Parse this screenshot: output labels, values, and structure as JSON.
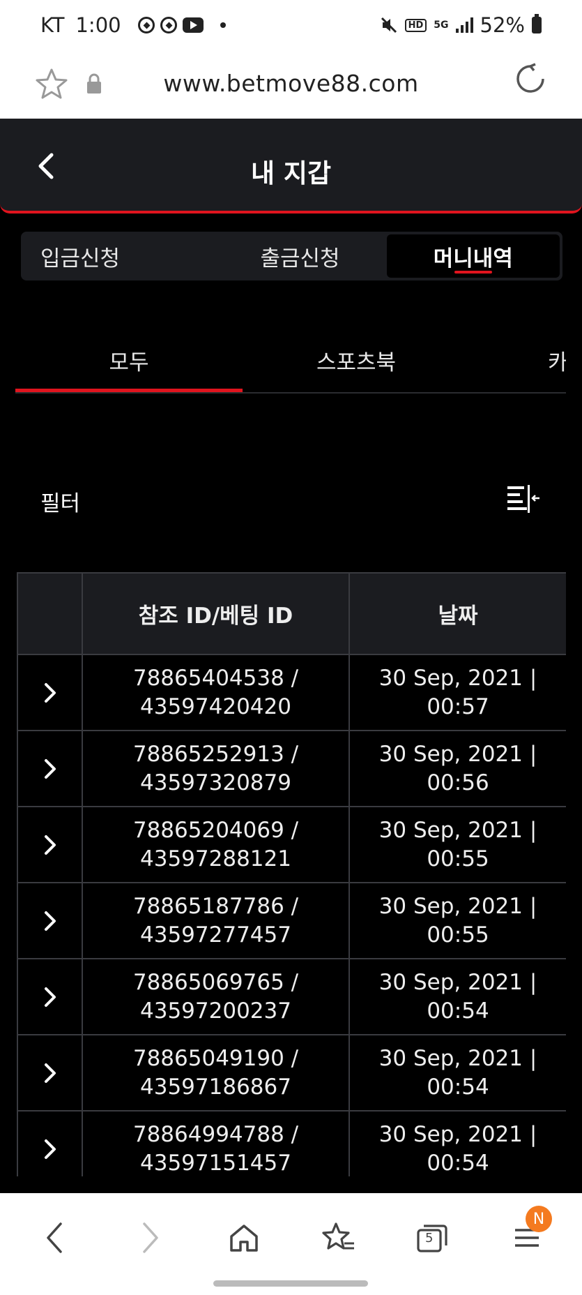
{
  "status_bar": {
    "carrier": "KT",
    "time": "1:00",
    "hd": "HD",
    "network": "5G",
    "battery": "52%"
  },
  "browser": {
    "url": "www.betmove88.com",
    "tab_count": "5",
    "menu_badge": "N"
  },
  "header": {
    "title": "내 지갑"
  },
  "segments": {
    "deposit": "입금신청",
    "withdraw": "출금신청",
    "history": "머니내역"
  },
  "subtabs": {
    "all": "모두",
    "sportsbook": "스포츠북",
    "next": "카"
  },
  "filter": {
    "label": "필터"
  },
  "table": {
    "headers": [
      "",
      "참조 ID/베팅 ID",
      "날짜"
    ],
    "rows": [
      {
        "ref": "78865404538 /",
        "bet": "43597420420",
        "date": "30 Sep, 2021 |",
        "time": "00:57"
      },
      {
        "ref": "78865252913 /",
        "bet": "43597320879",
        "date": "30 Sep, 2021 |",
        "time": "00:56"
      },
      {
        "ref": "78865204069 /",
        "bet": "43597288121",
        "date": "30 Sep, 2021 |",
        "time": "00:55"
      },
      {
        "ref": "78865187786 /",
        "bet": "43597277457",
        "date": "30 Sep, 2021 |",
        "time": "00:55"
      },
      {
        "ref": "78865069765 /",
        "bet": "43597200237",
        "date": "30 Sep, 2021 |",
        "time": "00:54"
      },
      {
        "ref": "78865049190 /",
        "bet": "43597186867",
        "date": "30 Sep, 2021 |",
        "time": "00:54"
      },
      {
        "ref": "78864994788 /",
        "bet": "43597151457",
        "date": "30 Sep, 2021 |",
        "time": "00:54"
      }
    ]
  },
  "colors": {
    "accent": "#e0141e",
    "header_bg": "#1b1c20",
    "badge": "#f47a1f"
  }
}
